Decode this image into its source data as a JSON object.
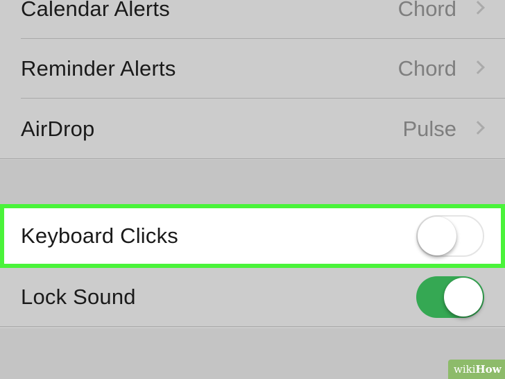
{
  "settings": {
    "rows": [
      {
        "label": "Calendar Alerts",
        "value": "Chord"
      },
      {
        "label": "Reminder Alerts",
        "value": "Chord"
      },
      {
        "label": "AirDrop",
        "value": "Pulse"
      }
    ],
    "keyboard_clicks": {
      "label": "Keyboard Clicks",
      "state": "off"
    },
    "lock_sound": {
      "label": "Lock Sound",
      "state": "on"
    }
  },
  "colors": {
    "highlight_border": "#4af33a",
    "toggle_on": "#35a853",
    "watermark_bg": "#8dbb6a"
  },
  "watermark": {
    "wiki": "wiki",
    "how": "How"
  }
}
